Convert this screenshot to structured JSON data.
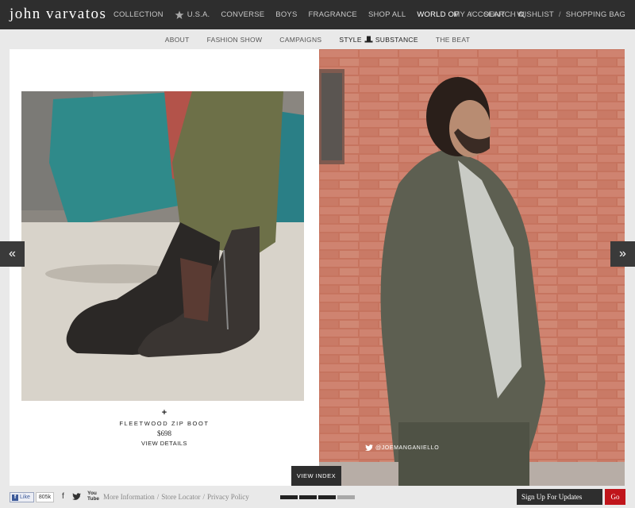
{
  "header": {
    "logo": "john varvatos",
    "main_nav": [
      "COLLECTION",
      "U.S.A.",
      "CONVERSE",
      "BOYS",
      "FRAGRANCE",
      "SHOP ALL",
      "WORLD OF"
    ],
    "search_label": "SEARCH",
    "account_nav": [
      "MY ACCOUNT",
      "WISHLIST",
      "SHOPPING BAG"
    ]
  },
  "subnav": {
    "items": [
      "ABOUT",
      "FASHION SHOW",
      "CAMPAIGNS",
      "THE BEAT"
    ],
    "style_pre": "STYLE",
    "style_post": "SUBSTANCE"
  },
  "product": {
    "plus": "+",
    "name": "FLEETWOOD ZIP BOOT",
    "price": "$698",
    "view_details": "VIEW DETAILS"
  },
  "photo_credit": "@JOEMANGANIELLO",
  "carousel": {
    "prev_glyph": "«",
    "next_glyph": "»",
    "view_index": "VIEW INDEX",
    "pager_active_count": 3
  },
  "footer": {
    "like_label": "Like",
    "like_count": "805k",
    "facebook_glyph": "f",
    "youtube_label": "You Tube",
    "links": [
      "More Information",
      "Store Locator",
      "Privacy Policy"
    ],
    "signup_label": "Sign Up For Updates",
    "go_label": "Go"
  },
  "colors": {
    "topbar": "#2e2e2e",
    "go_button": "#c0151b",
    "brick": "#c6745f"
  },
  "icons": [
    "star-icon",
    "search-icon",
    "hat-icon",
    "twitter-icon",
    "facebook-icon",
    "youtube-icon"
  ]
}
